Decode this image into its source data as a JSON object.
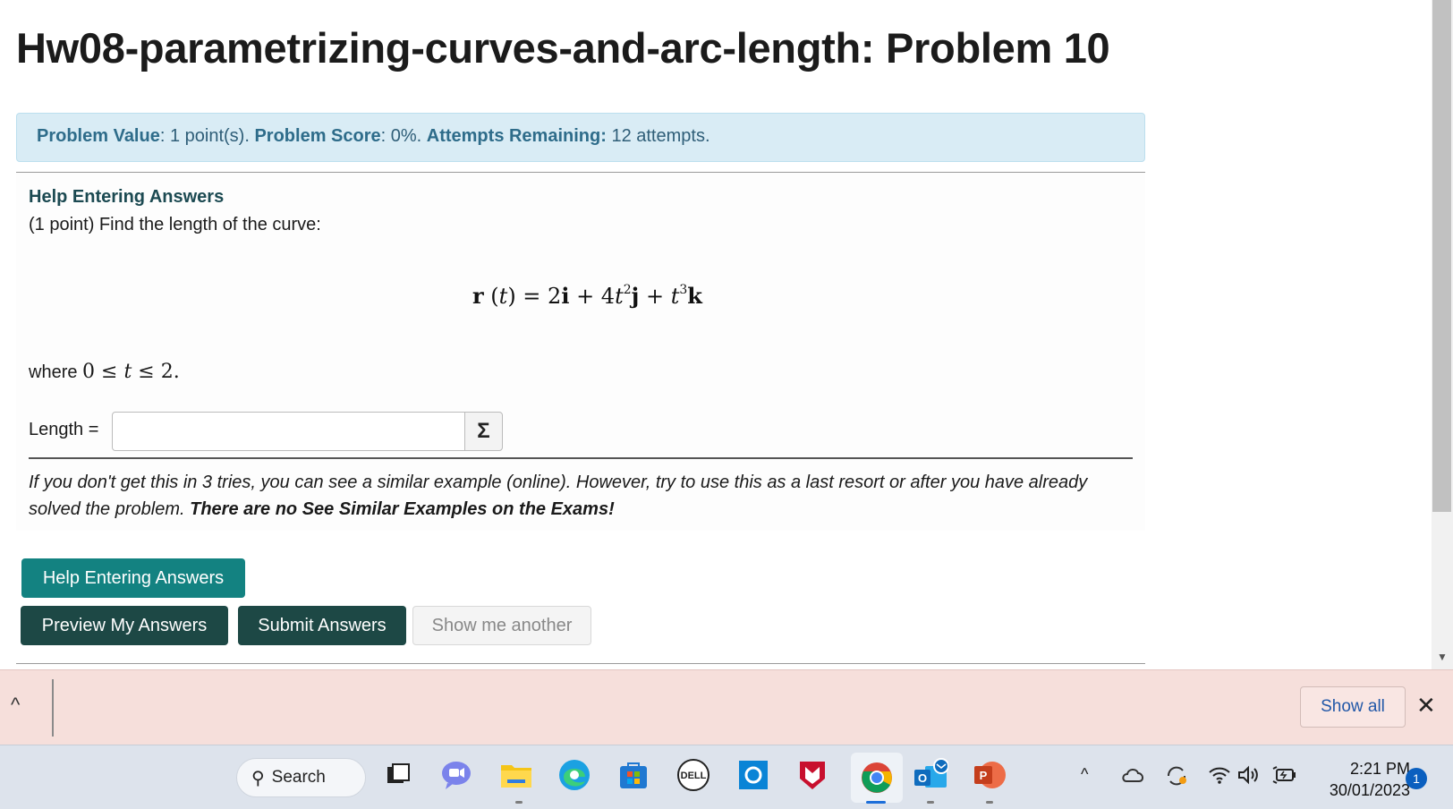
{
  "page": {
    "title": "Hw08-parametrizing-curves-and-arc-length: Problem 10"
  },
  "info": {
    "value_label": "Problem Value",
    "value_text": ": 1 point(s).",
    "score_label": "Problem Score",
    "score_text": ": 0%.",
    "attempts_label": "Attempts Remaining:",
    "attempts_text": "12 attempts."
  },
  "problem": {
    "help_link": "Help Entering Answers",
    "intro": "(1 point) Find the length of the curve:",
    "where_prefix": "where",
    "length_label": "Length =",
    "length_value": "",
    "sigma_label": "Σ",
    "note_part1": "If you don't get this in 3 tries, you can see a similar example (online). However, try to use this as a last resort or after you have already solved the problem.",
    "note_bold": "There are no See Similar Examples on the Exams!"
  },
  "buttons": {
    "help": "Help Entering Answers",
    "preview": "Preview My Answers",
    "submit": "Submit Answers",
    "another": "Show me another"
  },
  "download_shelf": {
    "show_all": "Show all",
    "close": "✕"
  },
  "taskbar": {
    "search_label": "Search",
    "time": "2:21 PM",
    "date": "30/01/2023",
    "notification_count": "1",
    "apps": [
      "windows-start",
      "search",
      "task-view",
      "teams-chat",
      "file-explorer",
      "edge",
      "microsoft-store",
      "dell",
      "cortana",
      "mcafee",
      "chrome",
      "outlook",
      "powerpoint"
    ]
  },
  "colors": {
    "info_bg": "#d9ecf5",
    "help_button": "#138281",
    "primary_button": "#1d4845",
    "shelf_bg": "#f6dfdb",
    "taskbar_bg": "#dde3ec"
  }
}
